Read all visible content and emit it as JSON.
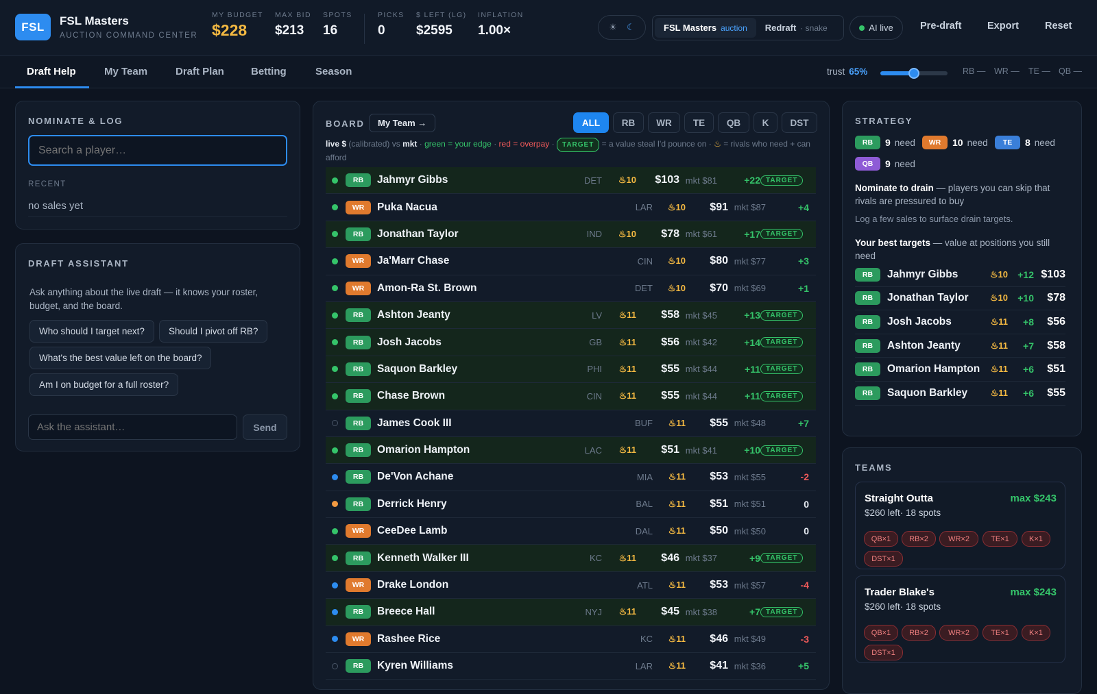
{
  "header": {
    "logo": "FSL",
    "title": "FSL Masters",
    "subtitle": "AUCTION COMMAND CENTER",
    "stats": [
      {
        "label": "MY BUDGET",
        "value": "$228"
      },
      {
        "label": "MAX BID",
        "value": "$213"
      },
      {
        "label": "SPOTS",
        "value": "16"
      },
      {
        "label": "PICKS",
        "value": "0"
      },
      {
        "label": "$ LEFT (LG)",
        "value": "$2595"
      },
      {
        "label": "INFLATION",
        "value": "1.00×"
      }
    ],
    "leagues": [
      {
        "name": "FSL Masters",
        "mode": "auction"
      },
      {
        "name": "Redraft",
        "mode": "snake"
      }
    ],
    "ai_status": "AI live",
    "buttons": [
      "Pre-draft",
      "Export",
      "Reset"
    ],
    "theme_icons": [
      "sun-icon",
      "moon-icon"
    ]
  },
  "tabs": [
    "Draft Help",
    "My Team",
    "Draft Plan",
    "Betting",
    "Season"
  ],
  "trust": {
    "label": "trust",
    "value": "65%",
    "value_fraction": 0.65,
    "positions": [
      "RB —",
      "WR —",
      "TE —",
      "QB —"
    ]
  },
  "nominate": {
    "title": "NOMINATE & LOG",
    "placeholder": "Search a player…",
    "recent_label": "RECENT",
    "recent_value": "no sales yet"
  },
  "assistant": {
    "title": "DRAFT ASSISTANT",
    "intro": "Ask anything about the live draft — it knows your roster, budget, and the board.",
    "suggestions": [
      "Who should I target next?",
      "Should I pivot off RB?",
      "What's the best value left on the board?",
      "Am I on budget for a full roster?"
    ],
    "placeholder": "Ask the assistant…",
    "send": "Send"
  },
  "board": {
    "title": "BOARD",
    "my_team_button": "My Team →",
    "filters": [
      "ALL",
      "RB",
      "WR",
      "TE",
      "QB",
      "K",
      "DST"
    ],
    "legend": {
      "a": "live $",
      "b": "(calibrated) vs",
      "c": "mkt",
      "d": "·",
      "e": "green = your edge",
      "f": "·",
      "g": "red = overpay",
      "h": "·",
      "tag": "TARGET",
      "i": "= a value steal I'd pounce on ·",
      "j": "= rivals who need + can afford"
    },
    "players": [
      {
        "name": "Jahmyr Gibbs",
        "pos": "RB",
        "team": "DET",
        "rivals": "10",
        "live": "$103",
        "mkt": "mkt $81",
        "edge": "+22",
        "target": "TARGET",
        "dot": "#35c46a",
        "hl": true
      },
      {
        "name": "Puka Nacua",
        "pos": "WR",
        "team": "LAR",
        "rivals": "10",
        "live": "$91",
        "mkt": "mkt $87",
        "edge": "+4",
        "target": "",
        "dot": "#35c46a",
        "hl": false
      },
      {
        "name": "Jonathan Taylor",
        "pos": "RB",
        "team": "IND",
        "rivals": "10",
        "live": "$78",
        "mkt": "mkt $61",
        "edge": "+17",
        "target": "TARGET",
        "dot": "#35c46a",
        "hl": true
      },
      {
        "name": "Ja'Marr Chase",
        "pos": "WR",
        "team": "CIN",
        "rivals": "10",
        "live": "$80",
        "mkt": "mkt $77",
        "edge": "+3",
        "target": "",
        "dot": "#35c46a",
        "hl": false
      },
      {
        "name": "Amon-Ra St. Brown",
        "pos": "WR",
        "team": "DET",
        "rivals": "10",
        "live": "$70",
        "mkt": "mkt $69",
        "edge": "+1",
        "target": "",
        "dot": "#35c46a",
        "hl": false
      },
      {
        "name": "Ashton Jeanty",
        "pos": "RB",
        "team": "LV",
        "rivals": "11",
        "live": "$58",
        "mkt": "mkt $45",
        "edge": "+13",
        "target": "TARGET",
        "dot": "#35c46a",
        "hl": true
      },
      {
        "name": "Josh Jacobs",
        "pos": "RB",
        "team": "GB",
        "rivals": "11",
        "live": "$56",
        "mkt": "mkt $42",
        "edge": "+14",
        "target": "TARGET",
        "dot": "#35c46a",
        "hl": true
      },
      {
        "name": "Saquon Barkley",
        "pos": "RB",
        "team": "PHI",
        "rivals": "11",
        "live": "$55",
        "mkt": "mkt $44",
        "edge": "+11",
        "target": "TARGET",
        "dot": "#35c46a",
        "hl": true
      },
      {
        "name": "Chase Brown",
        "pos": "RB",
        "team": "CIN",
        "rivals": "11",
        "live": "$55",
        "mkt": "mkt $44",
        "edge": "+11",
        "target": "TARGET",
        "dot": "#35c46a",
        "hl": true
      },
      {
        "name": "James Cook III",
        "pos": "RB",
        "team": "BUF",
        "rivals": "11",
        "live": "$55",
        "mkt": "mkt $48",
        "edge": "+7",
        "target": "",
        "dot": "ring",
        "hl": false
      },
      {
        "name": "Omarion Hampton",
        "pos": "RB",
        "team": "LAC",
        "rivals": "11",
        "live": "$51",
        "mkt": "mkt $41",
        "edge": "+10",
        "target": "TARGET",
        "dot": "#35c46a",
        "hl": true
      },
      {
        "name": "De'Von Achane",
        "pos": "RB",
        "team": "MIA",
        "rivals": "11",
        "live": "$53",
        "mkt": "mkt $55",
        "edge": "-2",
        "target": "",
        "dot": "#2d8cf0",
        "hl": false
      },
      {
        "name": "Derrick Henry",
        "pos": "RB",
        "team": "BAL",
        "rivals": "11",
        "live": "$51",
        "mkt": "mkt $51",
        "edge": "0",
        "target": "",
        "dot": "#f49b42",
        "hl": false
      },
      {
        "name": "CeeDee Lamb",
        "pos": "WR",
        "team": "DAL",
        "rivals": "11",
        "live": "$50",
        "mkt": "mkt $50",
        "edge": "0",
        "target": "",
        "dot": "#35c46a",
        "hl": false
      },
      {
        "name": "Kenneth Walker III",
        "pos": "RB",
        "team": "KC",
        "rivals": "11",
        "live": "$46",
        "mkt": "mkt $37",
        "edge": "+9",
        "target": "TARGET",
        "dot": "#35c46a",
        "hl": true
      },
      {
        "name": "Drake London",
        "pos": "WR",
        "team": "ATL",
        "rivals": "11",
        "live": "$53",
        "mkt": "mkt $57",
        "edge": "-4",
        "target": "",
        "dot": "#2d8cf0",
        "hl": false
      },
      {
        "name": "Breece Hall",
        "pos": "RB",
        "team": "NYJ",
        "rivals": "11",
        "live": "$45",
        "mkt": "mkt $38",
        "edge": "+7",
        "target": "TARGET",
        "dot": "#2d8cf0",
        "hl": true
      },
      {
        "name": "Rashee Rice",
        "pos": "WR",
        "team": "KC",
        "rivals": "11",
        "live": "$46",
        "mkt": "mkt $49",
        "edge": "-3",
        "target": "",
        "dot": "#2d8cf0",
        "hl": false
      },
      {
        "name": "Kyren Williams",
        "pos": "RB",
        "team": "LAR",
        "rivals": "11",
        "live": "$41",
        "mkt": "mkt $36",
        "edge": "+5",
        "target": "",
        "dot": "ring",
        "hl": false
      }
    ]
  },
  "strategy": {
    "title": "STRATEGY",
    "needs": [
      {
        "pos": "RB",
        "count": "9",
        "label": "need"
      },
      {
        "pos": "WR",
        "count": "10",
        "label": "need"
      },
      {
        "pos": "TE",
        "count": "8",
        "label": "need"
      },
      {
        "pos": "QB",
        "count": "9",
        "label": "need"
      }
    ],
    "drain_bold": "Nominate to drain",
    "drain_text": "— players you can skip that rivals are pressured to buy",
    "drain_note": "Log a few sales to surface drain targets.",
    "best_bold": "Your best targets",
    "best_text": "— value at positions you still need",
    "targets": [
      {
        "pos": "RB",
        "name": "Jahmyr Gibbs",
        "rivals": "10",
        "edge": "+12",
        "price": "$103"
      },
      {
        "pos": "RB",
        "name": "Jonathan Taylor",
        "rivals": "10",
        "edge": "+10",
        "price": "$78"
      },
      {
        "pos": "RB",
        "name": "Josh Jacobs",
        "rivals": "11",
        "edge": "+8",
        "price": "$56"
      },
      {
        "pos": "RB",
        "name": "Ashton Jeanty",
        "rivals": "11",
        "edge": "+7",
        "price": "$58"
      },
      {
        "pos": "RB",
        "name": "Omarion Hampton",
        "rivals": "11",
        "edge": "+6",
        "price": "$51"
      },
      {
        "pos": "RB",
        "name": "Saquon Barkley",
        "rivals": "11",
        "edge": "+6",
        "price": "$55"
      }
    ]
  },
  "teams": {
    "title": "TEAMS",
    "list": [
      {
        "name": "Straight Outta",
        "max": "max $243",
        "left": "$260 left",
        "spots": "· 18 spots",
        "needs": [
          "QB×1",
          "RB×2",
          "WR×2",
          "TE×1",
          "K×1",
          "DST×1"
        ]
      },
      {
        "name": "Trader Blake's",
        "max": "max $243",
        "left": "$260 left",
        "spots": "· 18 spots",
        "needs": [
          "QB×1",
          "RB×2",
          "WR×2",
          "TE×1",
          "K×1",
          "DST×1"
        ]
      }
    ]
  }
}
